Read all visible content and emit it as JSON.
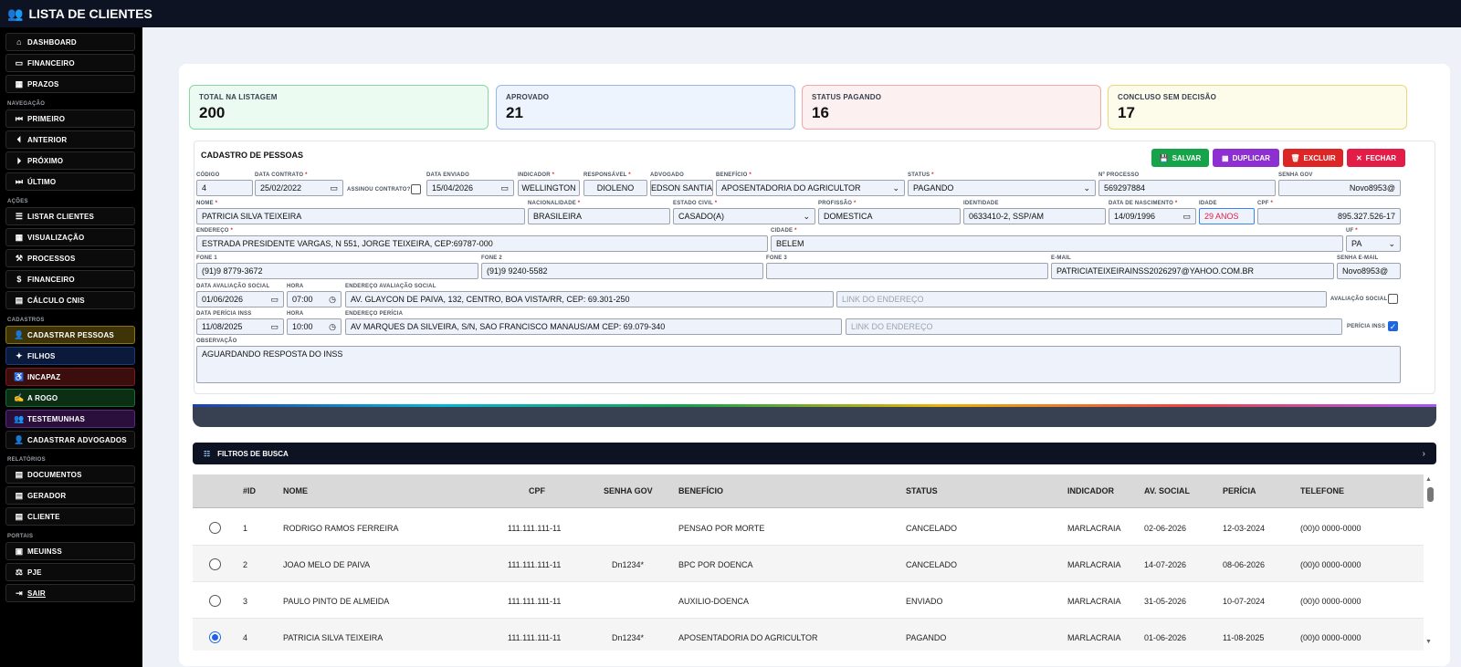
{
  "app": {
    "title": "LISTA DE CLIENTES"
  },
  "sidebar": {
    "top": [
      {
        "label": "DASHBOARD",
        "icon": "home-icon",
        "glyph": "⌂"
      },
      {
        "label": "FINANCEIRO",
        "icon": "wallet-icon",
        "glyph": "▭"
      },
      {
        "label": "PRAZOS",
        "icon": "calendar-icon",
        "glyph": "▦"
      }
    ],
    "sections": [
      {
        "title": "NAVEGAÇÃO",
        "items": [
          {
            "label": "PRIMEIRO",
            "glyph": "⏮"
          },
          {
            "label": "ANTERIOR",
            "glyph": "⏴"
          },
          {
            "label": "PRÓXIMO",
            "glyph": "⏵"
          },
          {
            "label": "ÚLTIMO",
            "glyph": "⏭"
          }
        ]
      },
      {
        "title": "AÇÕES",
        "items": [
          {
            "label": "LISTAR CLIENTES",
            "glyph": "☰"
          },
          {
            "label": "VISUALIZAÇÃO",
            "glyph": "▦"
          },
          {
            "label": "PROCESSOS",
            "glyph": "⚒"
          },
          {
            "label": "FINANCEIRO",
            "glyph": "$"
          },
          {
            "label": "CÁLCULO CNIS",
            "glyph": "▤"
          }
        ]
      },
      {
        "title": "CADASTROS",
        "items": [
          {
            "label": "CADASTRAR PESSOAS",
            "glyph": "👤",
            "color": "yel"
          },
          {
            "label": "FILHOS",
            "glyph": "✦",
            "color": "blu"
          },
          {
            "label": "INCAPAZ",
            "glyph": "♿",
            "color": "red"
          },
          {
            "label": "A ROGO",
            "glyph": "✍",
            "color": "grn"
          },
          {
            "label": "TESTEMUNHAS",
            "glyph": "👥",
            "color": "pur"
          },
          {
            "label": "CADASTRAR ADVOGADOS",
            "glyph": "👤"
          }
        ]
      },
      {
        "title": "RELATÓRIOS",
        "items": [
          {
            "label": "DOCUMENTOS",
            "glyph": "▤"
          },
          {
            "label": "GERADOR",
            "glyph": "▤"
          },
          {
            "label": "CLIENTE",
            "glyph": "▤"
          }
        ]
      },
      {
        "title": "PORTAIS",
        "items": [
          {
            "label": "MEUINSS",
            "glyph": "▣"
          },
          {
            "label": "PJE",
            "glyph": "⚖"
          },
          {
            "label": "SAIR",
            "glyph": "⇥"
          }
        ]
      }
    ]
  },
  "stats": [
    {
      "label": "TOTAL NA LISTAGEM",
      "value": "200",
      "bg": "#ecfbf1",
      "border": "#86d9a3"
    },
    {
      "label": "APROVADO",
      "value": "21",
      "bg": "#edf4fd",
      "border": "#93b8ea"
    },
    {
      "label": "STATUS PAGANDO",
      "value": "16",
      "bg": "#fdf0f0",
      "border": "#eeaaaa"
    },
    {
      "label": "CONCLUSO SEM DECISÃO",
      "value": "17",
      "bg": "#fdfbe9",
      "border": "#ead97b"
    }
  ],
  "form": {
    "title": "CADASTRO DE PESSOAS",
    "buttons": {
      "save": "SALVAR",
      "duplicate": "DUPLICAR",
      "delete": "EXCLUIR",
      "close": "FECHAR"
    },
    "labels": {
      "codigo": "CÓDIGO",
      "data_contrato": "DATA CONTRATO",
      "assinou": "ASSINOU CONTRATO?",
      "data_enviado": "DATA ENVIADO",
      "indicador": "INDICADOR",
      "responsavel": "RESPONSÁVEL",
      "advogado": "ADVOGADO",
      "beneficio": "BENEFÍCIO",
      "status": "STATUS",
      "processo": "Nº PROCESSO",
      "senha_gov": "SENHA GOV",
      "nome": "NOME",
      "nacionalidade": "NACIONALIDADE",
      "estado_civil": "ESTADO CIVIL",
      "profissao": "PROFISSÃO",
      "identidade": "IDENTIDADE",
      "nascimento": "DATA DE NASCIMENTO",
      "idade": "IDADE",
      "cpf": "CPF",
      "endereco": "ENDEREÇO",
      "cidade": "CIDADE",
      "uf": "UF",
      "fone1": "FONE 1",
      "fone2": "FONE 2",
      "fone3": "FONE 3",
      "email": "E-MAIL",
      "senha_email": "SENHA E-MAIL",
      "data_aval": "DATA AVALIAÇÃO SOCIAL",
      "hora": "HORA",
      "end_aval": "ENDEREÇO AVALIAÇÃO SOCIAL",
      "aval_social": "AVALIAÇÃO SOCIAL",
      "data_pericia": "DATA PERÍCIA INSS",
      "end_pericia": "ENDEREÇO PERÍCIA",
      "pericia_inss": "PERÍCIA INSS",
      "observacao": "OBSERVAÇÃO"
    },
    "values": {
      "codigo": "4",
      "data_contrato": "25/02/2022",
      "data_enviado": "15/04/2026",
      "indicador": "WELLINGTON",
      "responsavel": "DIOLENO",
      "advogado": "EDSON SANTIA",
      "beneficio": "APOSENTADORIA DO AGRICULTOR",
      "status": "PAGANDO",
      "processo": "569297884",
      "senha_gov": "Novo8953@",
      "nome": "PATRICIA SILVA TEIXEIRA",
      "nacionalidade": "BRASILEIRA",
      "estado_civil": "CASADO(A)",
      "profissao": "DOMESTICA",
      "identidade": "0633410-2, SSP/AM",
      "nascimento": "14/09/1996",
      "idade": "29 ANOS",
      "cpf": "895.327.526-17",
      "endereco": "ESTRADA PRESIDENTE VARGAS, N 551, JORGE TEIXEIRA, CEP:69787-000",
      "cidade": "BELEM",
      "uf": "PA",
      "fone1": "(91)9 8779-3672",
      "fone2": "(91)9 9240-5582",
      "fone3": "",
      "email": "PATRICIATEIXEIRAINSS2026297@YAHOO.COM.BR",
      "senha_email": "Novo8953@",
      "data_aval": "01/06/2026",
      "hora_aval": "07:00",
      "end_aval": "AV. GLAYCON DE PAIVA, 132, CENTRO, BOA VISTA/RR, CEP: 69.301-250",
      "link_placeholder": "LINK DO ENDEREÇO",
      "data_pericia": "11/08/2025",
      "hora_pericia": "10:00",
      "end_pericia": "AV MARQUES DA SILVEIRA, S/N, SAO FRANCISCO MANAUS/AM CEP: 69.079-340",
      "observacao": "AGUARDANDO RESPOSTA DO INSS",
      "assinou_checked": false,
      "aval_social_checked": false,
      "pericia_checked": true
    }
  },
  "filters": {
    "label": "FILTROS DE BUSCA"
  },
  "table": {
    "headers": {
      "id": "#ID",
      "nome": "NOME",
      "cpf": "CPF",
      "senha": "SENHA GOV",
      "beneficio": "BENEFÍCIO",
      "status": "STATUS",
      "indicador": "INDICADOR",
      "aval": "AV. SOCIAL",
      "pericia": "PERÍCIA",
      "telefone": "TELEFONE"
    },
    "rows": [
      {
        "id": "1",
        "nome": "RODRIGO RAMOS FERREIRA",
        "cpf": "111.111.111-11",
        "senha": "",
        "beneficio": "PENSAO POR MORTE",
        "status": "CANCELADO",
        "indicador": "MARLACRAIA",
        "aval": "02-06-2026",
        "pericia": "12-03-2024",
        "telefone": "(00)0 0000-0000",
        "selected": false
      },
      {
        "id": "2",
        "nome": "JOAO MELO DE PAIVA",
        "cpf": "111.111.111-11",
        "senha": "Dn1234*",
        "beneficio": "BPC POR DOENCA",
        "status": "CANCELADO",
        "indicador": "MARLACRAIA",
        "aval": "14-07-2026",
        "pericia": "08-06-2026",
        "telefone": "(00)0 0000-0000",
        "selected": false
      },
      {
        "id": "3",
        "nome": "PAULO PINTO DE ALMEIDA",
        "cpf": "111.111.111-11",
        "senha": "",
        "beneficio": "AUXILIO-DOENCA",
        "status": "ENVIADO",
        "indicador": "MARLACRAIA",
        "aval": "31-05-2026",
        "pericia": "10-07-2024",
        "telefone": "(00)0 0000-0000",
        "selected": false
      },
      {
        "id": "4",
        "nome": "PATRICIA SILVA TEIXEIRA",
        "cpf": "111.111.111-11",
        "senha": "Dn1234*",
        "beneficio": "APOSENTADORIA DO AGRICULTOR",
        "status": "PAGANDO",
        "indicador": "MARLACRAIA",
        "aval": "01-06-2026",
        "pericia": "11-08-2025",
        "telefone": "(00)0 0000-0000",
        "selected": true
      }
    ]
  }
}
